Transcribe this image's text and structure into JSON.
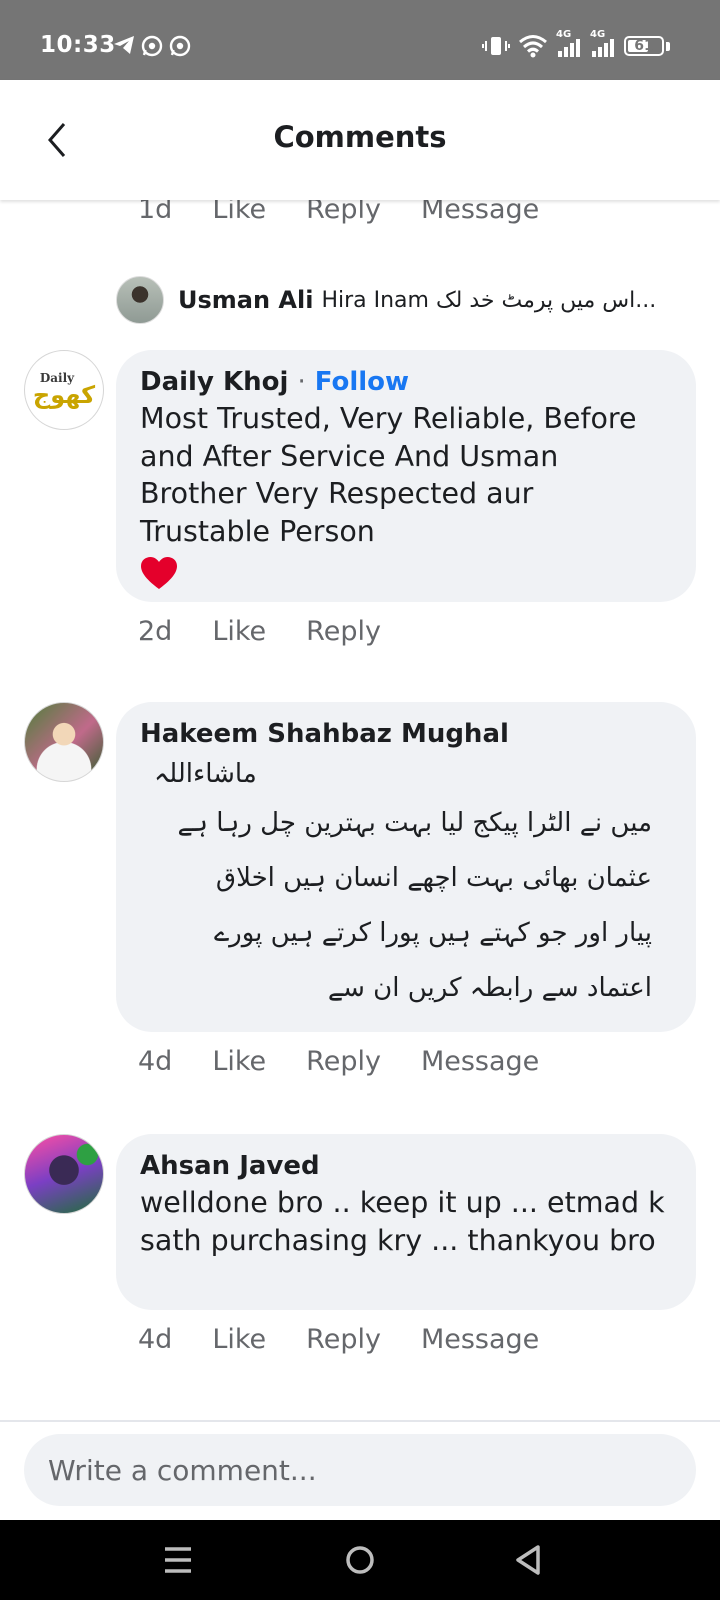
{
  "status_bar": {
    "time": "10:33",
    "battery_level": "61",
    "left_icons": [
      "telegram-icon",
      "whatsapp-icon",
      "whatsapp-icon"
    ],
    "right_icons": [
      "vibrate-icon",
      "wifi-icon",
      "signal-4g-icon",
      "signal-4g-icon",
      "battery-icon"
    ],
    "network_label_1": "4G",
    "network_label_2": "4G"
  },
  "header": {
    "title": "Comments",
    "back_icon": "chevron-left-icon"
  },
  "previous_actions": {
    "time": "1d",
    "like": "Like",
    "reply": "Reply",
    "message": "Message"
  },
  "reply_preview": {
    "name": "Usman Ali",
    "text": "Hira Inam اس میں پرمٹ خد لک..."
  },
  "comments": [
    {
      "name": "Daily Khoj",
      "follow_separator": "·",
      "follow": "Follow",
      "logo_text_1": "Daily",
      "logo_text_2": "کھوج",
      "text": "Most Trusted, Very Reliable, Before and After Service And Usman Brother Very Respected aur Trustable Person",
      "emoji": "❤️",
      "time": "2d",
      "like": "Like",
      "reply": "Reply"
    },
    {
      "name": "Hakeem Shahbaz Mughal",
      "lines": [
        "ماشاءاللہ",
        "میں نے الٹرا پیکج لیا بہت بہترین چل رہا ہے",
        "عثمان بھائی بہت اچھے انسان ہیں اخلاق",
        "پیار اور جو کہتے ہیں پورا کرتے ہیں پورے",
        "اعتماد سے رابطہ کریں ان سے"
      ],
      "time": "4d",
      "like": "Like",
      "reply": "Reply",
      "message": "Message"
    },
    {
      "name": "Ahsan Javed",
      "text": "welldone bro .. keep it up ... etmad k sath purchasing kry  ... thankyou bro",
      "time": "4d",
      "like": "Like",
      "reply": "Reply",
      "message": "Message"
    }
  ],
  "composer": {
    "placeholder": "Write a comment..."
  },
  "nav_bar": {
    "icons": [
      "menu-icon",
      "home-icon",
      "back-icon"
    ]
  },
  "colors": {
    "status_bar": "#757575",
    "bubble": "#f0f2f5",
    "link_blue": "#1877f2",
    "meta_gray": "#65676b"
  }
}
